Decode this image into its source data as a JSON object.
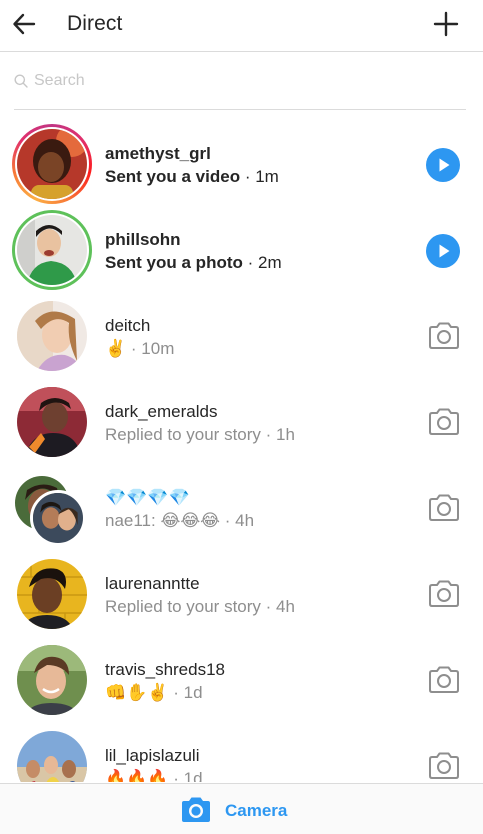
{
  "header": {
    "title": "Direct",
    "back_icon": "arrow-left-icon",
    "new_icon": "plus-icon"
  },
  "search": {
    "placeholder": "Search",
    "icon": "search-icon"
  },
  "threads": [
    {
      "name": "amethyst_grl",
      "preview": "Sent you a video",
      "time": " · 1m",
      "unread": true,
      "ring": "story-gradient",
      "action": "play"
    },
    {
      "name": "phillsohn",
      "preview": "Sent you a photo",
      "time": " · 2m",
      "unread": true,
      "ring": "close-friends-green",
      "action": "play"
    },
    {
      "name": "deitch",
      "preview": "✌️",
      "time": " · 10m",
      "unread": false,
      "action": "camera"
    },
    {
      "name": "dark_emeralds",
      "preview": "Replied to your story",
      "time": " · 1h",
      "unread": false,
      "action": "camera"
    },
    {
      "name": "💎💎💎💎",
      "preview": "nae11: 😂😂😂",
      "time": " · 4h",
      "unread": false,
      "group": true,
      "action": "camera"
    },
    {
      "name": "laurenanntte",
      "preview": "Replied to your story",
      "time": " · 4h",
      "unread": false,
      "action": "camera"
    },
    {
      "name": "travis_shreds18",
      "preview": "👊✋✌️",
      "time": " · 1d",
      "unread": false,
      "action": "camera"
    },
    {
      "name": "lil_lapislazuli",
      "preview": "🔥🔥🔥",
      "time": " · 1d",
      "unread": false,
      "action": "camera"
    }
  ],
  "bottom_bar": {
    "camera_label": "Camera",
    "camera_icon": "camera-icon"
  },
  "colors": {
    "accent": "#2d97f1",
    "text": "#262626",
    "secondary_text": "#8e8e8e",
    "divider": "#dbdbdb",
    "close_friends_ring": "#5ec15a"
  }
}
